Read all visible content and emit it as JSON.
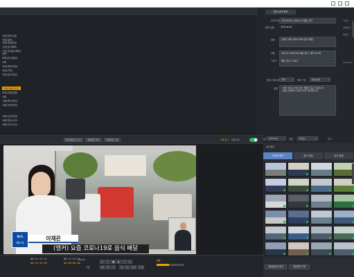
{
  "top_panel": {
    "left_tree": [
      "국방(방위사업)",
      "국방(일반)",
      "국방(재외부대)",
      "기상(일기예보)",
      "기상(국외일기예보)",
      "과학",
      "과학(우주/항공)",
      "교육",
      "국외(경제/산업)",
      "국외(기타)",
      "국외(정치/외교)",
      "국외(재난/사고)",
      "국외(전쟁/분쟁)",
      "사회",
      "사회(복지/보건)",
      "사회(가정/육아)",
      "사회(인권/여성)",
      "사회(재난/사고)",
      "사회(사건/사고)",
      "스포츠"
    ],
    "left_tree_selected": "국외(재난/사고)"
  },
  "details": {
    "title": "영상 상세 정보",
    "clip_name_label": "비디오파일",
    "clip_name_value": "20200619_코로나19 배달_요리",
    "shot_label": "촬영 날짜",
    "shot_value": "2020 ▪ 06",
    "rows": [
      {
        "label": "제목",
        "value": "[앵커] 요즘 코로나19로 음식 배달"
      },
      {
        "label": "내용",
        "value": "코로나19 확산으로 배달 증가, 대면 최소화"
      },
      {
        "label": "키워드",
        "value": "배달, 음식, 코로나"
      }
    ],
    "side_labels": [
      "사이즈",
      "촬영장비",
      "해상도",
      "Georgian"
    ],
    "filter_label_1": "등록 카테고리",
    "filter_value_1": "전체",
    "filter_label_2": "등록 구분",
    "filter_value_2": "방송 영상",
    "memo_label": "설명",
    "memo_lines": [
      "- 요즘 코로나19로 음식 배달이 늘고 있습니다.",
      "- 배달 과정에서 위생 관리가 중요합니다."
    ],
    "date_label": "등록일",
    "date_value": "2020-06",
    "sort_label": "정렬",
    "sort_value": "최신순",
    "view_label": "보기"
  },
  "toolbar": {
    "buttons": [
      "영상클립보기 닫기",
      "재생편집 폐기",
      "재생편집 삭제"
    ],
    "right_label": "자막 표시",
    "right_value": "자막 보기"
  },
  "video": {
    "logo_line1": "뉴스",
    "logo_line2": "에스지",
    "anchor_name": "이재은",
    "caption": "(앵커) 요즘 코로나19로 음식 배달"
  },
  "controls": {
    "time_current": "00:22:15:03",
    "time_total": "00:00:00:00",
    "time_label_in": "00:11:11:11",
    "time_label_out": "00:11:11:11",
    "mark_label": "MOVIE",
    "buttons": [
      "<<",
      "<",
      "■",
      "▶",
      ">",
      ">>",
      "+1",
      "+5",
      "+10",
      "+15"
    ],
    "row2_buttons": [
      "-10",
      "-5",
      "-1"
    ],
    "volume_label": "음량",
    "volume_fraction": 0.45,
    "save_label": "저장"
  },
  "thumbs": {
    "header": "검색 결과",
    "tabs": [
      "스토리 보드",
      "참고 영상",
      "유사 영상"
    ],
    "active_tab": 0,
    "colors": [
      [
        "#b6c6d8",
        "#7c7c7c"
      ],
      [
        "#d3cfc2",
        "#2c3b52"
      ],
      [
        "#d0d7e0",
        "#6a7b8a"
      ],
      [
        "#c0cfb2",
        "#5a6b3a"
      ],
      [
        "#c6cde0",
        "#333d55"
      ],
      [
        "#ccd5c8",
        "#3b4a3a"
      ],
      [
        "#c3c8cc",
        "#4b6a8a"
      ],
      [
        "#cfd0c4",
        "#5c7e3a"
      ],
      [
        "#9aa6b8",
        "#d8d8d8"
      ],
      [
        "#5a5f66",
        "#35383c"
      ],
      [
        "#b0b8c2",
        "#6f7f8f"
      ],
      [
        "#9fc5a5",
        "#2f6f3f"
      ],
      [
        "#7c8fa8",
        "#c8c8c8"
      ],
      [
        "#5a6f8f",
        "#2f3f5f"
      ],
      [
        "#bfc9d2",
        "#6a7f8f"
      ],
      [
        "#9ab0c6",
        "#3f5a7a"
      ],
      [
        "#c2c8cf",
        "#556577"
      ],
      [
        "#cfd6df",
        "#3b5c8a"
      ],
      [
        "#aeb8c2",
        "#4e5b6a"
      ],
      [
        "#c6d6cf",
        "#4a6a5a"
      ],
      [
        "#8f9fb6",
        "#2a3648"
      ],
      [
        "#d0c8c0",
        "#6f5f4f"
      ],
      [
        "#9aa8b4",
        "#3c4a58"
      ],
      [
        "#b7c3cf",
        "#505e6c"
      ]
    ],
    "bottom_buttons": [
      "썸네일검색 결과",
      "대표화면 지정"
    ]
  },
  "window": {
    "panel_label": "전체 사이즈",
    "percent_label": "100%"
  }
}
